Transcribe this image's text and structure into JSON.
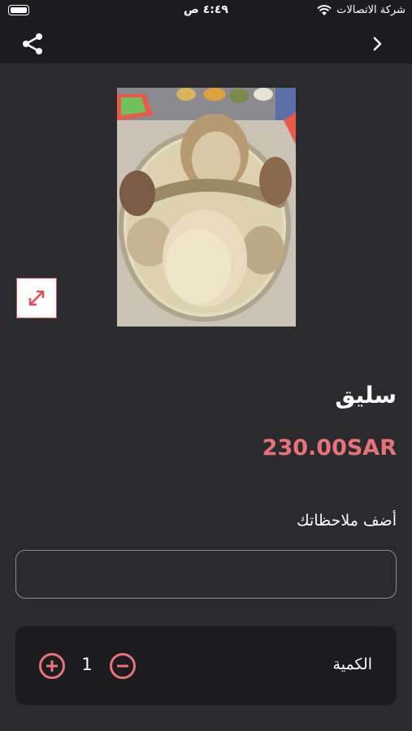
{
  "status_bar": {
    "time": "٤:٤٩ ص",
    "carrier": "شركة الاتصالات",
    "icons": [
      "battery-icon",
      "wifi-icon"
    ]
  },
  "nav": {
    "icons": [
      "share-icon",
      "chevron-right-icon"
    ]
  },
  "product": {
    "name": "سليق",
    "price": "230.00SAR",
    "image_alt": "سليق",
    "expand_icon": "expand-arrows-icon"
  },
  "notes": {
    "label": "أضف ملاحظاتك",
    "value": "",
    "placeholder": ""
  },
  "quantity": {
    "label": "الكمية",
    "count": "1",
    "increase_icon": "plus-circle-icon",
    "decrease_icon": "minus-circle-icon"
  },
  "colors": {
    "background": "#2b2b2e",
    "bar": "#1c1c1e",
    "accent": "#e04b5a",
    "price": "#e8727a"
  }
}
